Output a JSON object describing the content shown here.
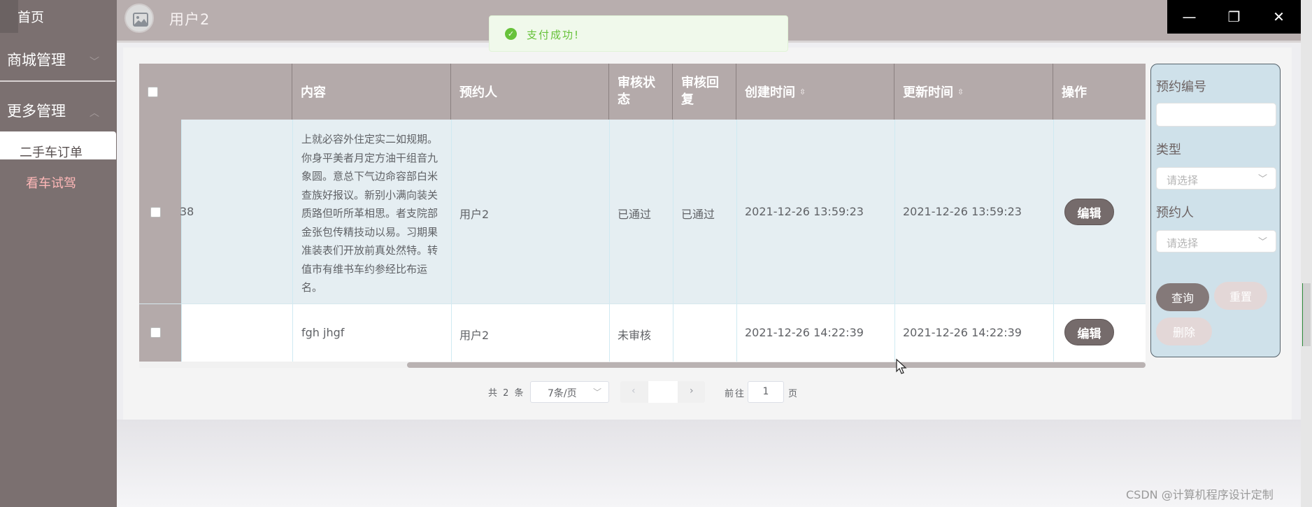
{
  "sidebar": {
    "home": "首页",
    "groups": [
      {
        "label": "商城管理",
        "chevron": "﹀"
      },
      {
        "label": "更多管理",
        "chevron": "︿"
      }
    ],
    "items": [
      {
        "label": "二手车订单"
      },
      {
        "label": "看车试驾"
      }
    ]
  },
  "topbar": {
    "username": "用户2",
    "window_controls": {
      "minimize": "—",
      "restore": "❐",
      "close": "✕"
    }
  },
  "toast": {
    "icon": "check-circle-icon",
    "text": "支付成功!"
  },
  "table": {
    "columns": {
      "col_id": "",
      "content": "内容",
      "reserver": "预约人",
      "review_status": "审核状态",
      "review_reply": "审核回复",
      "created": "创建时间",
      "updated": "更新时间",
      "actions": "操作"
    },
    "sort_glyph": "⇳",
    "rows": [
      {
        "id": "38",
        "content": "上就必容外住定实二如规期。你身平美者月定方油干组音九象圆。意总下气边命容部白米查族好报议。新别小满向装关质路但听所革相思。者支院部金张包传精技动以易。习期果准装表们开放前真处然特。转值市有维书车约参经比布运名。",
        "reserver": "用户2",
        "review_status": "已通过",
        "review_reply": "已通过",
        "created": "2021-12-26 13:59:23",
        "updated": "2021-12-26 13:59:23",
        "action": "编辑"
      },
      {
        "id": "",
        "content": "fgh jhgf",
        "reserver": "用户2",
        "review_status": "未审核",
        "review_reply": "",
        "created": "2021-12-26 14:22:39",
        "updated": "2021-12-26 14:22:39",
        "action": "编辑"
      }
    ]
  },
  "search": {
    "reservation_no": {
      "label": "预约编号",
      "value": ""
    },
    "type": {
      "label": "类型",
      "placeholder": "请选择"
    },
    "reserver": {
      "label": "预约人",
      "placeholder": "请选择"
    },
    "buttons": {
      "query": "查询",
      "reset": "重置",
      "delete": "删除"
    },
    "select_arrow": "﹀"
  },
  "pagination": {
    "total": "共 2 条",
    "page_size": "7条/页",
    "prev": "‹",
    "next": "›",
    "goto_label": "前往",
    "goto_value": "1",
    "page_unit": "页"
  },
  "watermark": "CSDN @计算机程序设计定制",
  "colors": {
    "sidebar": "#7b7070",
    "topbar": "#b8aeae",
    "table_header": "#b4aaaa",
    "row_highlight": "#e5eef2",
    "search_panel": "#cfe1ea",
    "success": "#67c23a",
    "action_button": "#756b6b"
  }
}
